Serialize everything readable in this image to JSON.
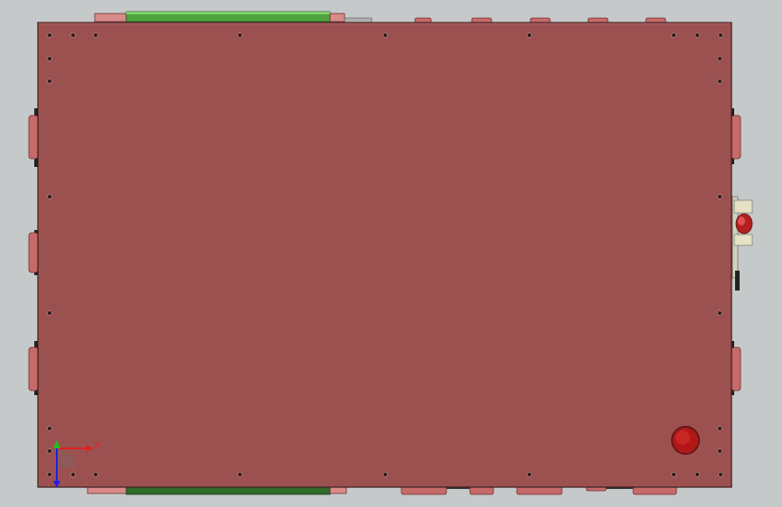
{
  "view": {
    "model": "enclosure-top-view",
    "colors": {
      "background": "#c6c9ca",
      "plate": "#9c5151",
      "plate_edge": "#3a1e1e",
      "green_strip": "#4ea33f",
      "dark_green_strip": "#2f6b2b",
      "tab": "#c76a6a",
      "button": "#b31616"
    }
  },
  "triad": {
    "x_label": "X",
    "y_label": "Y",
    "z_label": "Z",
    "x_color": "#e02020",
    "y_color": "#20c020",
    "z_color": "#2020e0"
  }
}
